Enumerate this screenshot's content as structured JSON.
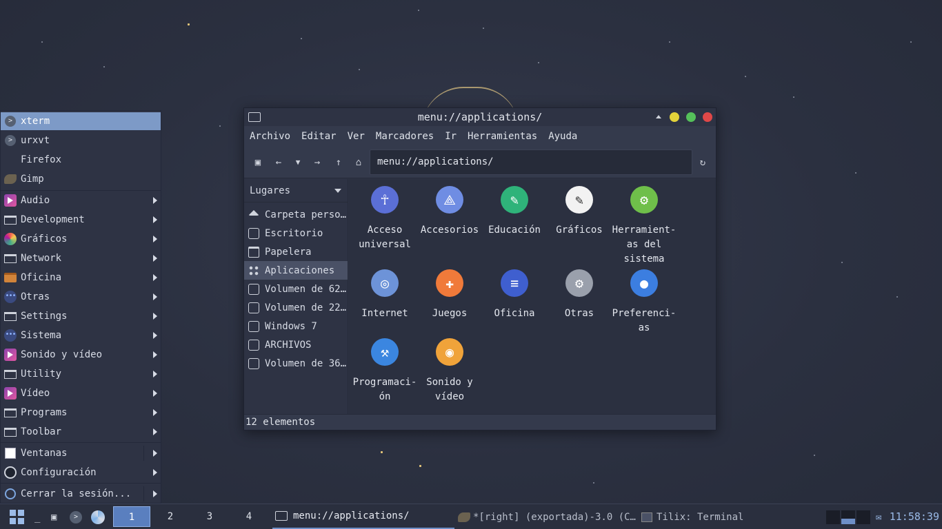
{
  "start_menu": {
    "items": [
      {
        "label": "xterm",
        "icon": "terminal-icon"
      },
      {
        "label": "urxvt",
        "icon": "terminal-icon"
      },
      {
        "label": "Firefox",
        "icon": "firefox-icon"
      },
      {
        "label": "Gimp",
        "icon": "gimp-icon"
      },
      {
        "label": "Audio",
        "icon": "multimedia-icon"
      },
      {
        "label": "Development",
        "icon": "window-icon"
      },
      {
        "label": "Gráficos",
        "icon": "palette-icon"
      },
      {
        "label": "Network",
        "icon": "window-icon"
      },
      {
        "label": "Oficina",
        "icon": "briefcase-icon"
      },
      {
        "label": "Otras",
        "icon": "dots-icon"
      },
      {
        "label": "Settings",
        "icon": "window-icon"
      },
      {
        "label": "Sistema",
        "icon": "dots-icon"
      },
      {
        "label": "Sonido y vídeo",
        "icon": "multimedia-icon"
      },
      {
        "label": "Utility",
        "icon": "window-icon"
      },
      {
        "label": "Vídeo",
        "icon": "multimedia-icon"
      },
      {
        "label": "Programs",
        "icon": "window-icon"
      },
      {
        "label": "Toolbar",
        "icon": "window-icon"
      },
      {
        "label": "Ventanas",
        "icon": "white-window-icon"
      },
      {
        "label": "Configuración",
        "icon": "gear-icon"
      },
      {
        "label": "Cerrar la sesión...",
        "icon": "power-icon"
      }
    ]
  },
  "file_manager": {
    "title": "menu://applications/",
    "menubar": [
      "Archivo",
      "Editar",
      "Ver",
      "Marcadores",
      "Ir",
      "Herramientas",
      "Ayuda"
    ],
    "address": "menu://applications/",
    "sidebar_header": "Lugares",
    "places": [
      {
        "label": "Carpeta perso…",
        "icon": "home-icon"
      },
      {
        "label": "Escritorio",
        "icon": "desktop-icon"
      },
      {
        "label": "Papelera",
        "icon": "trash-icon"
      },
      {
        "label": "Aplicaciones",
        "icon": "grid-icon"
      },
      {
        "label": "Volumen de 62…",
        "icon": "disk-icon"
      },
      {
        "label": "Volumen de 22…",
        "icon": "disk-icon"
      },
      {
        "label": "Windows 7",
        "icon": "disk-icon"
      },
      {
        "label": "ARCHIVOS",
        "icon": "disk-icon"
      },
      {
        "label": "Volumen de 36…",
        "icon": "disk-icon"
      }
    ],
    "apps": [
      {
        "line1": "Acceso",
        "line2": "universal",
        "line3": "",
        "color": "#5b6fd6",
        "icon": "accessibility-icon"
      },
      {
        "line1": "Accesorios",
        "line2": "",
        "line3": "",
        "color": "#6f8de3",
        "icon": "compass-icon"
      },
      {
        "line1": "Educación",
        "line2": "",
        "line3": "",
        "color": "#2fb37a",
        "icon": "dna-icon"
      },
      {
        "line1": "Gráficos",
        "line2": "",
        "line3": "",
        "color": "#f2f2f2",
        "icon": "brush-icon"
      },
      {
        "line1": "Herramient-",
        "line2": "as del",
        "line3": "sistema",
        "color": "#6fbf4a",
        "icon": "gear-icon"
      },
      {
        "line1": "Internet",
        "line2": "",
        "line3": "",
        "color": "#6d93d8",
        "icon": "globe-icon"
      },
      {
        "line1": "Juegos",
        "line2": "",
        "line3": "",
        "color": "#f07a3a",
        "icon": "gamepad-icon"
      },
      {
        "line1": "Oficina",
        "line2": "",
        "line3": "",
        "color": "#3f5fcf",
        "icon": "document-icon"
      },
      {
        "line1": "Otras",
        "line2": "",
        "line3": "",
        "color": "#9aa0ac",
        "icon": "gear-icon"
      },
      {
        "line1": "Preferenci-",
        "line2": "as",
        "line3": "",
        "color": "#3c7ee0",
        "icon": "toggle-icon"
      },
      {
        "line1": "Programaci-",
        "line2": "ón",
        "line3": "",
        "color": "#3b86e0",
        "icon": "hammer-icon"
      },
      {
        "line1": "Sonido y",
        "line2": "vídeo",
        "line3": "",
        "color": "#f0a33a",
        "icon": "speaker-icon"
      }
    ],
    "status": "12 elementos"
  },
  "taskbar": {
    "workspaces": [
      "1",
      "2",
      "3",
      "4"
    ],
    "tasks": [
      {
        "label": "menu://applications/",
        "icon": "folder-icon"
      },
      {
        "label": "*[right] (exportada)-3.0 (C…",
        "icon": "gimp-icon"
      },
      {
        "label": "Tilix: Terminal",
        "icon": "terminal-icon"
      }
    ],
    "clock": "11:58:39"
  }
}
